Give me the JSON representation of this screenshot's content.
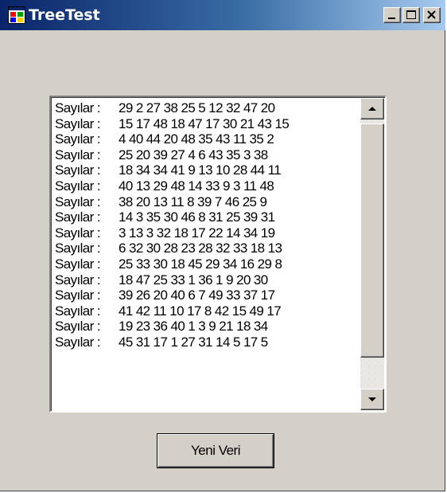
{
  "window": {
    "title": "TreeTest",
    "title_color": "#ffffff",
    "titlebar_colors": [
      "#0a246a",
      "#a6caf0"
    ],
    "background": "#d4d0c8",
    "icon": "app-window-icon"
  },
  "caption_buttons": [
    "minimize-icon",
    "maximize-icon",
    "close-icon"
  ],
  "listbox": {
    "items": [
      {
        "label": "Sayılar :",
        "numbers": "29 2 27 38 25 5 12 32 47 20"
      },
      {
        "label": "Sayılar :",
        "numbers": "15 17 48 18 47 17 30 21 43 15"
      },
      {
        "label": "Sayılar :",
        "numbers": "4 40 44 20 48 35 43 11 35 2"
      },
      {
        "label": "Sayılar :",
        "numbers": "25 20 39 27 4 6 43 35 3 38"
      },
      {
        "label": "Sayılar :",
        "numbers": "18 34 34 41 9 13 10 28 44 11"
      },
      {
        "label": "Sayılar :",
        "numbers": "40 13 29 48 14 33 9 3 11 48"
      },
      {
        "label": "Sayılar :",
        "numbers": "38 20 13 11 8 39 7 46 25 9"
      },
      {
        "label": "Sayılar :",
        "numbers": "14 3 35 30 46 8 31 25 39 31"
      },
      {
        "label": "Sayılar :",
        "numbers": "3 13 3 32 18 17 22 14 34 19"
      },
      {
        "label": "Sayılar :",
        "numbers": "6 32 30 28 23 28 32 33 18 13"
      },
      {
        "label": "Sayılar :",
        "numbers": "25 33 30 18 45 29 34 16 29 8"
      },
      {
        "label": "Sayılar :",
        "numbers": "18 47 25 33 1 36 1 9 20 30"
      },
      {
        "label": "Sayılar :",
        "numbers": "39 26 20 40 6 7 49 33 37 17"
      },
      {
        "label": "Sayılar :",
        "numbers": "41 42 11 10 17 8 42 15 49 17"
      },
      {
        "label": "Sayılar :",
        "numbers": "19 23 36 40 1 3 9 21 18 34"
      },
      {
        "label": "Sayılar :",
        "numbers": "45 31 17 1 27 31 14 5 17 5"
      }
    ],
    "scrollbar": {
      "up_icon": "scroll-up-arrow-icon",
      "down_icon": "scroll-down-arrow-icon",
      "position_fraction": 0.0
    }
  },
  "button": {
    "label": "Yeni Veri"
  }
}
